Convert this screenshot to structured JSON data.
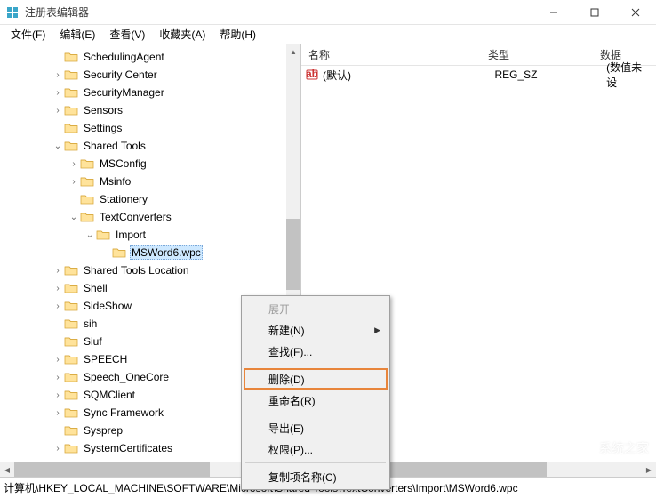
{
  "window": {
    "title": "注册表编辑器"
  },
  "menu": {
    "file": "文件(F)",
    "edit": "编辑(E)",
    "view": "查看(V)",
    "favorites": "收藏夹(A)",
    "help": "帮助(H)"
  },
  "tree": [
    {
      "indent": 3,
      "expander": "",
      "label": "SchedulingAgent"
    },
    {
      "indent": 3,
      "expander": ">",
      "label": "Security Center"
    },
    {
      "indent": 3,
      "expander": ">",
      "label": "SecurityManager"
    },
    {
      "indent": 3,
      "expander": ">",
      "label": "Sensors"
    },
    {
      "indent": 3,
      "expander": "",
      "label": "Settings"
    },
    {
      "indent": 3,
      "expander": "v",
      "label": "Shared Tools"
    },
    {
      "indent": 4,
      "expander": ">",
      "label": "MSConfig"
    },
    {
      "indent": 4,
      "expander": ">",
      "label": "Msinfo"
    },
    {
      "indent": 4,
      "expander": "",
      "label": "Stationery"
    },
    {
      "indent": 4,
      "expander": "v",
      "label": "TextConverters"
    },
    {
      "indent": 5,
      "expander": "v",
      "label": "Import"
    },
    {
      "indent": 6,
      "expander": "",
      "label": "MSWord6.wpc",
      "selected": true
    },
    {
      "indent": 3,
      "expander": ">",
      "label": "Shared Tools Location"
    },
    {
      "indent": 3,
      "expander": ">",
      "label": "Shell"
    },
    {
      "indent": 3,
      "expander": ">",
      "label": "SideShow"
    },
    {
      "indent": 3,
      "expander": "",
      "label": "sih"
    },
    {
      "indent": 3,
      "expander": "",
      "label": "Siuf"
    },
    {
      "indent": 3,
      "expander": ">",
      "label": "SPEECH"
    },
    {
      "indent": 3,
      "expander": ">",
      "label": "Speech_OneCore"
    },
    {
      "indent": 3,
      "expander": ">",
      "label": "SQMClient"
    },
    {
      "indent": 3,
      "expander": ">",
      "label": "Sync Framework"
    },
    {
      "indent": 3,
      "expander": "",
      "label": "Sysprep"
    },
    {
      "indent": 3,
      "expander": ">",
      "label": "SystemCertificates"
    }
  ],
  "columns": {
    "name": "名称",
    "type": "类型",
    "data": "数据"
  },
  "values": [
    {
      "name": "(默认)",
      "type": "REG_SZ",
      "data": "(数值未设"
    }
  ],
  "context": {
    "expand": "展开",
    "new": "新建(N)",
    "find": "查找(F)...",
    "delete": "删除(D)",
    "rename": "重命名(R)",
    "export": "导出(E)",
    "permissions": "权限(P)...",
    "copykey": "复制项名称(C)"
  },
  "statusbar": "计算机\\HKEY_LOCAL_MACHINE\\SOFTWARE\\Microsoft\\Shared Tools\\TextConverters\\Import\\MSWord6.wpc",
  "watermark": "系统之家"
}
